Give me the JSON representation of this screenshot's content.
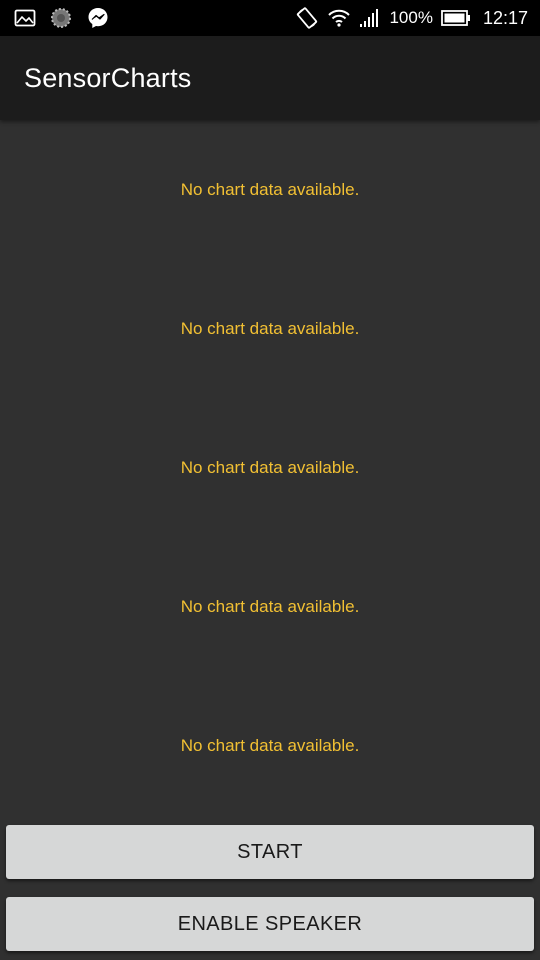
{
  "status_bar": {
    "left_icons": [
      "gallery-icon",
      "loading-icon",
      "messenger-icon"
    ],
    "right_icons": [
      "screen-rotate-icon",
      "wifi-icon",
      "signal-icon",
      "battery-icon"
    ],
    "battery_percent": "100%",
    "time": "12:17"
  },
  "app_bar": {
    "title": "SensorCharts"
  },
  "charts": [
    {
      "empty_text": "No chart data available."
    },
    {
      "empty_text": "No chart data available."
    },
    {
      "empty_text": "No chart data available."
    },
    {
      "empty_text": "No chart data available."
    },
    {
      "empty_text": "No chart data available."
    }
  ],
  "buttons": {
    "start_label": "START",
    "speaker_label": "ENABLE SPEAKER"
  },
  "colors": {
    "background": "#303030",
    "app_bar": "#1c1c1c",
    "empty_text": "#f2c033",
    "button": "#d6d7d7"
  }
}
